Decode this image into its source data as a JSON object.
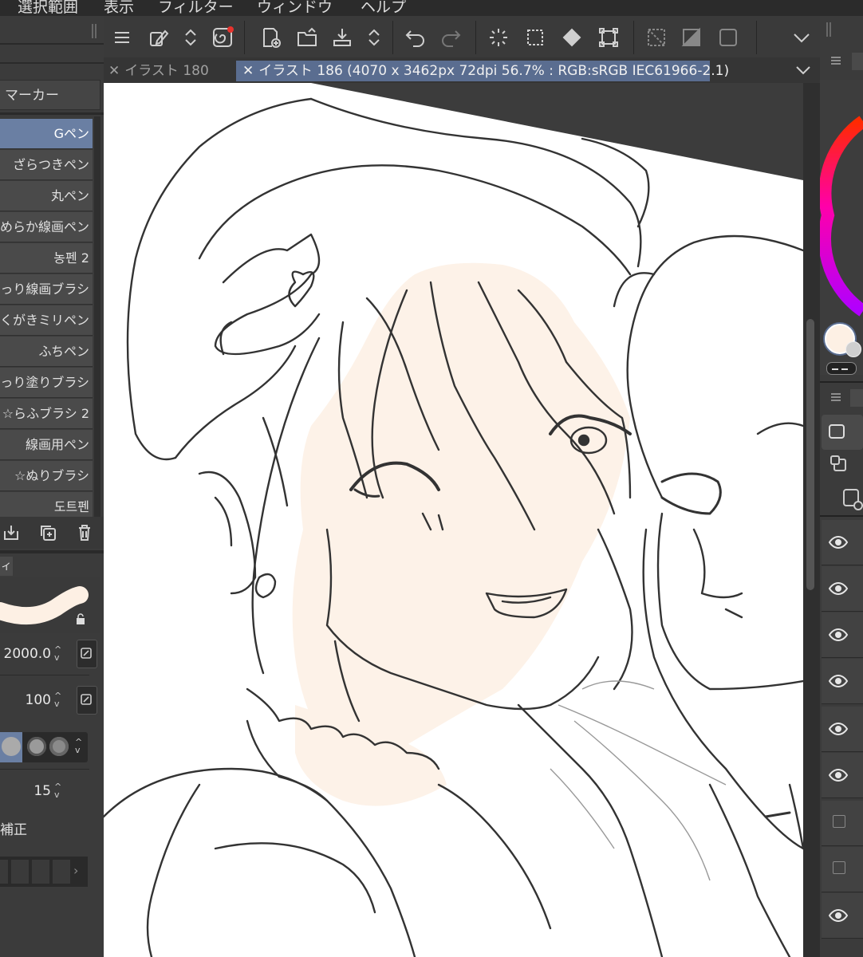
{
  "menu": {
    "items": [
      "選択範囲",
      "表示",
      "フィルター",
      "ウィンドウ",
      "ヘルプ"
    ]
  },
  "tabs": [
    {
      "label": "イラスト 180"
    },
    {
      "label": "イラスト 186 (4070 x 3462px 72dpi 56.7% : RGB:sRGB IEC61966-2.1)"
    }
  ],
  "tab_close_glyph": "✕",
  "brush_panel": {
    "group": "マーカー",
    "brushes": [
      {
        "label": "Gペン",
        "selected": true
      },
      {
        "label": "ざらつきペン"
      },
      {
        "label": "丸ペン"
      },
      {
        "label": "めらか線画ペン"
      },
      {
        "label": "농펜 2"
      },
      {
        "label": "っり線画ブラシ"
      },
      {
        "label": "くがきミリペン"
      },
      {
        "label": "ふちペン"
      },
      {
        "label": "っり塗りブラシ"
      },
      {
        "label": "☆らふブラシ 2"
      },
      {
        "label": "線画用ペン"
      },
      {
        "label": "☆ぬりブラシ"
      },
      {
        "label": "도트펜"
      }
    ]
  },
  "tool_property": {
    "tab_label": "ィ",
    "size_value": "2000.0",
    "opacity_value": "100",
    "stabilization_value": "15",
    "correction_label": "補正"
  },
  "colors": {
    "accent_tab": "#5a6d90",
    "selected_brush": "#6a7fa3",
    "main_color": "#fdf0e4",
    "skin_fill": "#fdf2e8",
    "line": "#333333"
  },
  "icons": {
    "toolbar": [
      "menu-icon",
      "edit-brush-icon",
      "arrow-updown-icon",
      "spiral-icon",
      "new-canvas-icon",
      "open-folder-icon",
      "export-icon",
      "arrow-updown-icon",
      "undo-icon",
      "redo-icon",
      "loading-icon",
      "select-icon",
      "fill-icon",
      "transform-icon",
      "clear-icon",
      "fill-layer-icon",
      "selection-border-icon",
      "chevron-down-icon"
    ]
  }
}
